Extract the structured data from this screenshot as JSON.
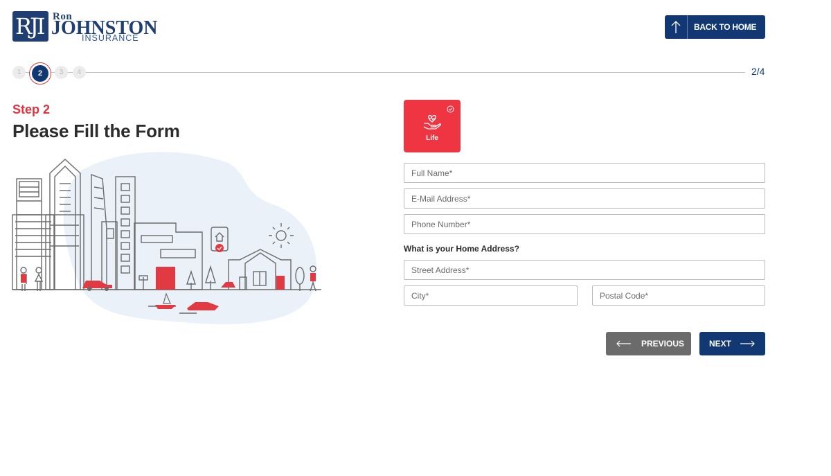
{
  "logo": {
    "monogram": "RJI",
    "line1": "Ron",
    "line2": "JOHNSTON",
    "line3": "INSURANCE"
  },
  "header": {
    "back_label": "BACK TO HOME"
  },
  "progress": {
    "steps": [
      "1",
      "2",
      "3",
      "4"
    ],
    "current_step": 2,
    "total_steps": 4,
    "counter": "2/4"
  },
  "intro": {
    "step_label": "Step 2",
    "title": "Please Fill the Form"
  },
  "category": {
    "label": "Life",
    "selected": true
  },
  "form": {
    "full_name": {
      "placeholder": "Full Name*",
      "value": ""
    },
    "email": {
      "placeholder": "E-Mail Address*",
      "value": ""
    },
    "phone": {
      "placeholder": "Phone Number*",
      "value": ""
    },
    "address_heading": "What is your Home Address?",
    "street": {
      "placeholder": "Street Address*",
      "value": ""
    },
    "city": {
      "placeholder": "City*",
      "value": ""
    },
    "postal": {
      "placeholder": "Postal Code*",
      "value": ""
    }
  },
  "nav": {
    "previous_label": "PREVIOUS",
    "next_label": "NEXT"
  },
  "colors": {
    "navy": "#123873",
    "red": "#ef3442",
    "grey_button": "#6b6b6b"
  }
}
